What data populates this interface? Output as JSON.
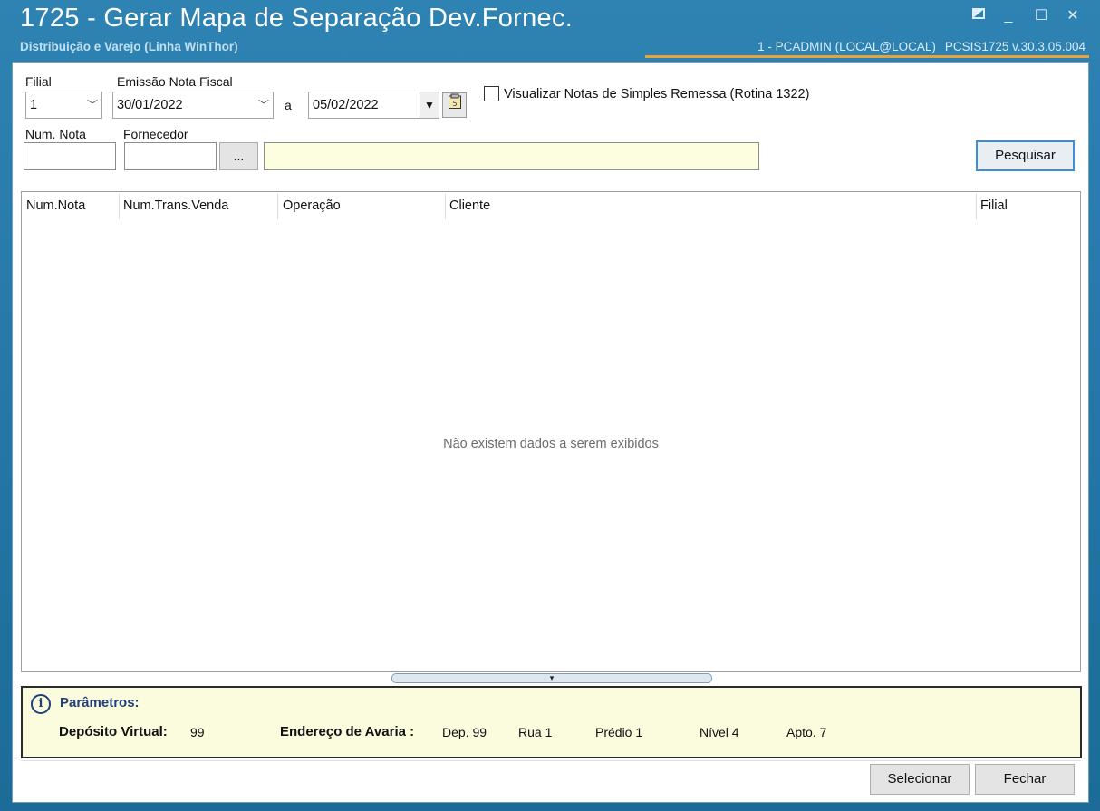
{
  "window": {
    "title": "1725 - Gerar Mapa de Separação Dev.Fornec.",
    "subtitle": "Distribuição e Varejo (Linha WinThor)",
    "user_info": "1 - PCADMIN (LOCAL@LOCAL)",
    "version_info": "PCSIS1725  v.30.3.05.004",
    "controls": {
      "restore_icon": "restore-icon",
      "minimize": "_",
      "maximize": "☐",
      "close": "✕"
    }
  },
  "filters": {
    "filial_label": "Filial",
    "filial_value": "1",
    "emissao_label": "Emissão Nota Fiscal",
    "date_start": "30/01/2022",
    "date_sep": "a",
    "date_end": "05/02/2022",
    "simples_remessa_label": "Visualizar Notas de Simples Remessa (Rotina 1322)",
    "num_nota_label": "Num. Nota",
    "num_nota_value": "",
    "fornecedor_label": "Fornecedor",
    "fornecedor_code": "",
    "fornecedor_lookup_label": "...",
    "fornecedor_name": "",
    "search_button": "Pesquisar"
  },
  "grid": {
    "columns": [
      "Num.Nota",
      "Num.Trans.Venda",
      "Operação",
      "Cliente",
      "Filial"
    ],
    "rows": [],
    "empty_message": "Não existem dados a serem exibidos"
  },
  "params": {
    "title": "Parâmetros:",
    "deposito_label": "Depósito Virtual:",
    "deposito_value": "99",
    "endereco_label": "Endereço de Avaria :",
    "dep": "Dep. 99",
    "rua": "Rua  1",
    "predio": "Prédio 1",
    "nivel": "Nível  4",
    "apto": "Apto. 7"
  },
  "actions": {
    "select": "Selecionar",
    "close": "Fechar"
  },
  "colors": {
    "title_bar": "#2e83b3",
    "params_bg": "#fbfbde",
    "accent_orange": "#e7a23a",
    "fornecedor_field": "#fdfde0"
  }
}
